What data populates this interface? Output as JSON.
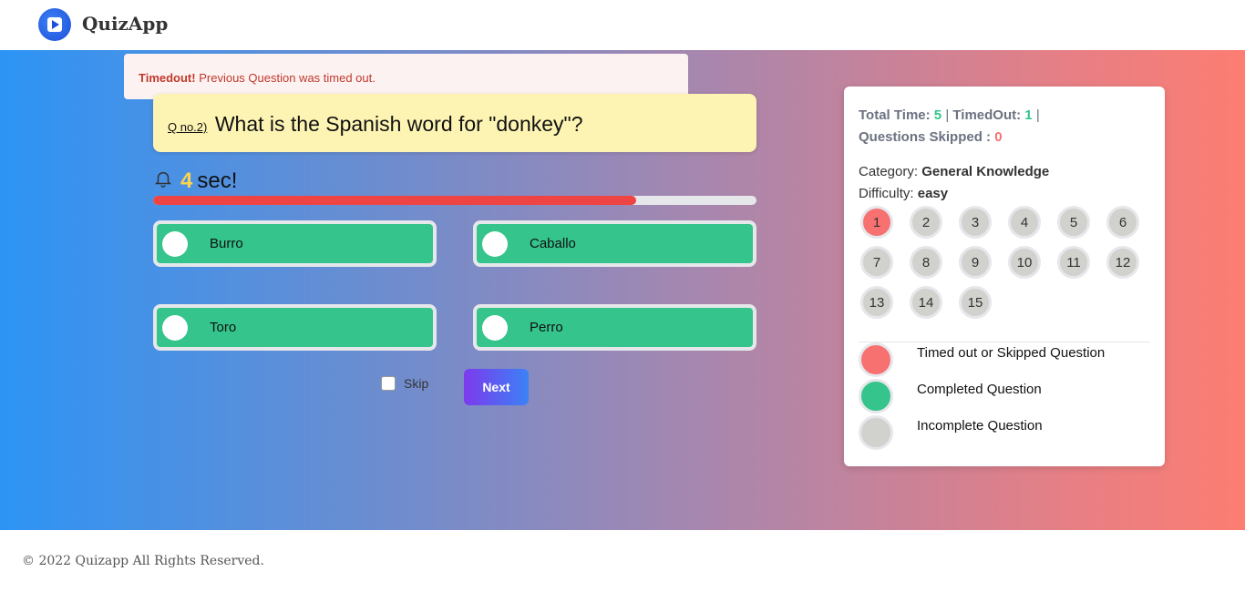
{
  "app": {
    "name": "QuizApp"
  },
  "alert": {
    "title": "Timedout!",
    "message": "Previous Question was timed out."
  },
  "question": {
    "number_label": "Q no.2)",
    "text": "What is the Spanish word for \"donkey\"?"
  },
  "timer": {
    "value": "4",
    "unit": "sec!",
    "progress_fraction": 0.8
  },
  "options": [
    {
      "label": "Burro"
    },
    {
      "label": "Caballo"
    },
    {
      "label": "Toro"
    },
    {
      "label": "Perro"
    }
  ],
  "controls": {
    "skip_label": "Skip",
    "next_label": "Next"
  },
  "stats": {
    "total_time_label": "Total Time:",
    "total_time_value": "5",
    "timedout_label": "TimedOut:",
    "timedout_value": "1",
    "skipped_label": "Questions Skipped :",
    "skipped_value": "0"
  },
  "meta": {
    "category_label": "Category:",
    "category_value": "General Knowledge",
    "difficulty_label": "Difficulty:",
    "difficulty_value": "easy"
  },
  "questions_grid": [
    {
      "label": "1",
      "status": "timed_out"
    },
    {
      "label": "2",
      "status": "incomplete"
    },
    {
      "label": "3",
      "status": "incomplete"
    },
    {
      "label": "4",
      "status": "incomplete"
    },
    {
      "label": "5",
      "status": "incomplete"
    },
    {
      "label": "6",
      "status": "incomplete"
    },
    {
      "label": "7",
      "status": "incomplete"
    },
    {
      "label": "8",
      "status": "incomplete"
    },
    {
      "label": "9",
      "status": "incomplete"
    },
    {
      "label": "10",
      "status": "incomplete"
    },
    {
      "label": "11",
      "status": "incomplete"
    },
    {
      "label": "12",
      "status": "incomplete"
    },
    {
      "label": "13",
      "status": "incomplete"
    },
    {
      "label": "14",
      "status": "incomplete"
    },
    {
      "label": "15",
      "status": "incomplete"
    }
  ],
  "legend": [
    {
      "label": "Timed out or Skipped Question",
      "color": "#f87171"
    },
    {
      "label": "Completed Question",
      "color": "#34c48c"
    },
    {
      "label": "Incomplete Question",
      "color": "#d1d1cd"
    }
  ],
  "footer": {
    "text": "© 2022 Quizapp All Rights Reserved."
  },
  "colors": {
    "accent_green": "#34c48c",
    "accent_red": "#f87171",
    "question_bg": "#fdf4b4",
    "timer_fill": "#ef4444"
  }
}
